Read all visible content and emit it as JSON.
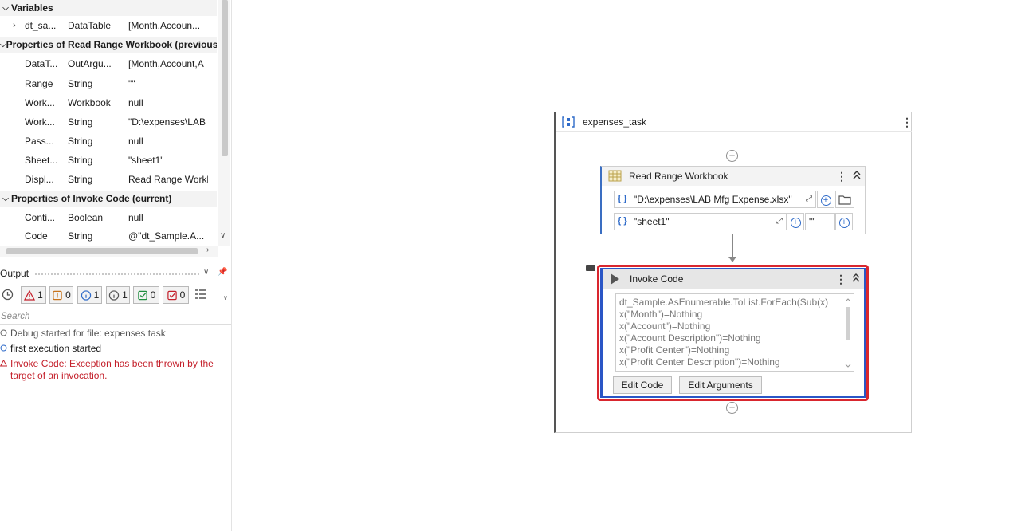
{
  "variables": {
    "title": "Variables",
    "items": [
      {
        "name": "dt_sa...",
        "type": "DataTable",
        "value": "[Month,Accoun..."
      }
    ]
  },
  "rrw_props": {
    "title": "Properties of Read Range Workbook (previous",
    "items": [
      {
        "name": "DataT...",
        "type": "OutArgu...",
        "value": "[Month,Account,A"
      },
      {
        "name": "Range",
        "type": "String",
        "value": "\"\""
      },
      {
        "name": "Work...",
        "type": "Workbook",
        "value": "null"
      },
      {
        "name": "Work...",
        "type": "String",
        "value": "\"D:\\expenses\\LAB"
      },
      {
        "name": "Pass...",
        "type": "String",
        "value": "null"
      },
      {
        "name": "Sheet...",
        "type": "String",
        "value": "\"sheet1\""
      },
      {
        "name": "Displ...",
        "type": "String",
        "value": "Read Range Workl"
      }
    ]
  },
  "ic_props": {
    "title": "Properties of Invoke Code (current)",
    "items": [
      {
        "name": "Conti...",
        "type": "Boolean",
        "value": "null"
      },
      {
        "name": "Code",
        "type": "String",
        "value": "@\"dt_Sample.A..."
      }
    ]
  },
  "output": {
    "title": "Output",
    "search_placeholder": "Search",
    "counts": {
      "errors": "1",
      "warnings": "0",
      "info": "1",
      "trace": "1",
      "success": "0",
      "failed": "0"
    },
    "log": [
      {
        "icon": "debug",
        "text": "Debug started for file: expenses task"
      },
      {
        "icon": "info",
        "text": "first execution started"
      },
      {
        "icon": "error",
        "text": "Invoke Code: Exception has been thrown by the target of an invocation."
      }
    ],
    "colors": {
      "error": "#c4202b",
      "warning": "#c8731b",
      "info": "#2f6bc9",
      "success": "#1e8e3e"
    }
  },
  "canvas": {
    "sequence_title": "expenses_task",
    "read_range": {
      "title": "Read Range Workbook",
      "path": "\"D:\\expenses\\LAB Mfg Expense.xlsx\"",
      "sheet": "\"sheet1\"",
      "range": "\"\""
    },
    "invoke_code": {
      "title": "Invoke Code",
      "code_lines": [
        "dt_Sample.AsEnumerable.ToList.ForEach(Sub(x)",
        "x(\"Month\")=Nothing",
        "x(\"Account\")=Nothing",
        "x(\"Account Description\")=Nothing",
        "x(\"Profit Center\")=Nothing",
        "x(\"Profit Center Description\")=Nothing"
      ],
      "edit_code_label": "Edit Code",
      "edit_arguments_label": "Edit Arguments"
    },
    "colors": {
      "error_border": "#d9262e",
      "selection_border": "#2a56c6"
    }
  }
}
